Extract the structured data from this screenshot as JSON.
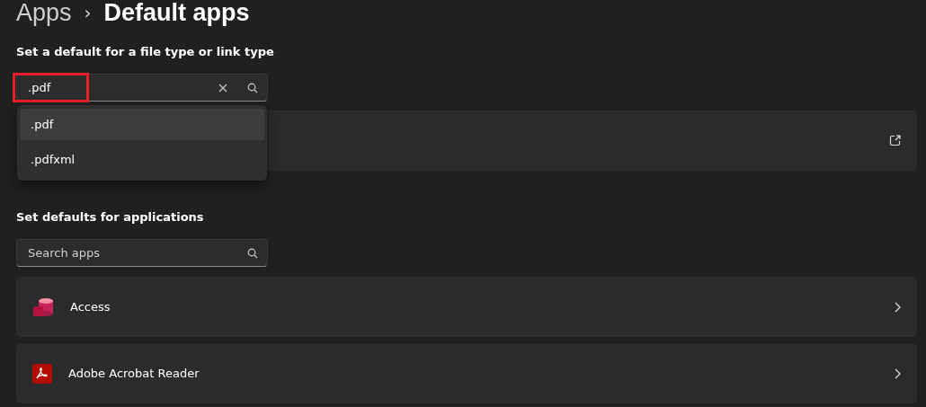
{
  "breadcrumb": {
    "parent": "Apps",
    "separator": "›",
    "current": "Default apps"
  },
  "file_type_section": {
    "heading": "Set a default for a file type or link type",
    "search": {
      "value": ".pdf",
      "highlighted": true
    },
    "suggestions": [
      {
        "label": ".pdf",
        "selected": true
      },
      {
        "label": ".pdfxml",
        "selected": false
      }
    ]
  },
  "apps_section": {
    "heading": "Set defaults for applications",
    "search": {
      "placeholder": "Search apps"
    },
    "apps": [
      {
        "name": "Access",
        "kind": "access"
      },
      {
        "name": "Adobe Acrobat Reader",
        "kind": "acrobat"
      }
    ]
  }
}
